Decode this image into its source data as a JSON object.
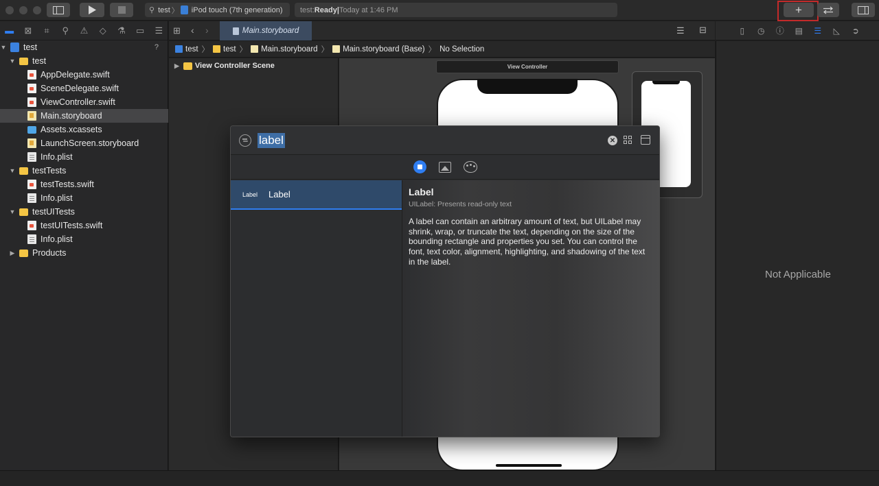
{
  "toolbar": {
    "scheme": "test",
    "scheme_sep": "〉",
    "device": "iPod touch (7th generation)",
    "status_project": "test: ",
    "status_state": "Ready",
    "status_sep": " | ",
    "status_time": "Today at 1:46 PM",
    "library_button_glyph": "+"
  },
  "navigator": {
    "badge": "?",
    "items": [
      {
        "label": "test",
        "kind": "project"
      },
      {
        "label": "test",
        "kind": "folder"
      },
      {
        "label": "AppDelegate.swift",
        "kind": "swift"
      },
      {
        "label": "SceneDelegate.swift",
        "kind": "swift"
      },
      {
        "label": "ViewController.swift",
        "kind": "swift"
      },
      {
        "label": "Main.storyboard",
        "kind": "storyboard",
        "selected": true
      },
      {
        "label": "Assets.xcassets",
        "kind": "assets"
      },
      {
        "label": "LaunchScreen.storyboard",
        "kind": "storyboard"
      },
      {
        "label": "Info.plist",
        "kind": "plist"
      },
      {
        "label": "testTests",
        "kind": "folder"
      },
      {
        "label": "testTests.swift",
        "kind": "swift"
      },
      {
        "label": "Info.plist",
        "kind": "plist"
      },
      {
        "label": "testUITests",
        "kind": "folder"
      },
      {
        "label": "testUITests.swift",
        "kind": "swift"
      },
      {
        "label": "Info.plist",
        "kind": "plist"
      },
      {
        "label": "Products",
        "kind": "folder"
      }
    ]
  },
  "editor": {
    "tab_label": "Main.storyboard",
    "breadcrumbs": [
      "test",
      "test",
      "Main.storyboard",
      "Main.storyboard (Base)",
      "No Selection"
    ],
    "scene_label": "View Controller Scene",
    "canvas_title": "View Controller"
  },
  "inspector": {
    "empty_text": "Not Applicable"
  },
  "library": {
    "search_value": "label",
    "clear_glyph": "✕",
    "item_thumb": "Label",
    "item_name": "Label",
    "detail_title": "Label",
    "detail_subtitle": "UILabel: Presents read-only text",
    "detail_description": "A label can contain an arbitrary amount of text, but UILabel may shrink, wrap, or truncate the text, depending on the size of the bounding rectangle and properties you set. You can control the font, text color, alignment, highlighting, and shadowing of the text in the label."
  },
  "colors": {
    "accent": "#2f7ef2",
    "highlight_box": "#c42a2a",
    "selection": "#2f4a6a"
  }
}
